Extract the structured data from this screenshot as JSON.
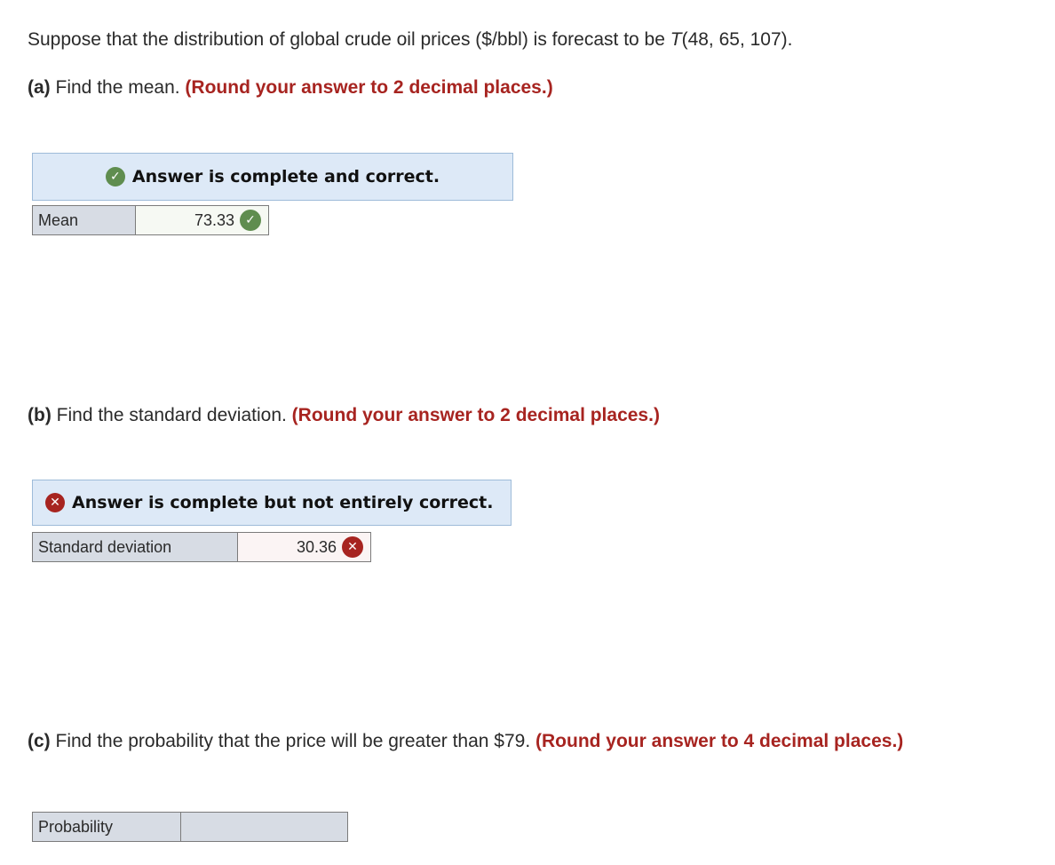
{
  "intro": {
    "text": "Suppose that the distribution of global crude oil prices ($/bbl) is forecast to be ",
    "dist_symbol": "T",
    "dist_params": "(48, 65, 107)."
  },
  "parts": [
    {
      "id": "a",
      "label": "(a)",
      "question": " Find the mean. ",
      "hint": "(Round your answer to 2 decimal places.)",
      "banner": {
        "status": "correct",
        "icon": "check-circle-icon",
        "text": "Answer is complete and correct."
      },
      "field": {
        "label": "Mean",
        "value": "73.33",
        "result_icon": "check-circle-icon"
      }
    },
    {
      "id": "b",
      "label": "(b)",
      "question": " Find the standard deviation. ",
      "hint": "(Round your answer to 2 decimal places.)",
      "banner": {
        "status": "incorrect",
        "icon": "x-circle-icon",
        "text": "Answer is complete but not entirely correct."
      },
      "field": {
        "label": "Standard deviation",
        "value": "30.36",
        "result_icon": "x-circle-icon"
      }
    },
    {
      "id": "c",
      "label": "(c)",
      "question": " Find the probability that the price will be greater than $79. ",
      "hint": "(Round your answer to 4 decimal places.)",
      "field": {
        "label": "Probability",
        "value": ""
      }
    }
  ],
  "colors": {
    "correct": "#5f8d4f",
    "incorrect": "#a72420",
    "hint": "#a72420",
    "banner_bg": "#dde9f7"
  },
  "glyphs": {
    "check": "✓",
    "cross": "✕"
  }
}
